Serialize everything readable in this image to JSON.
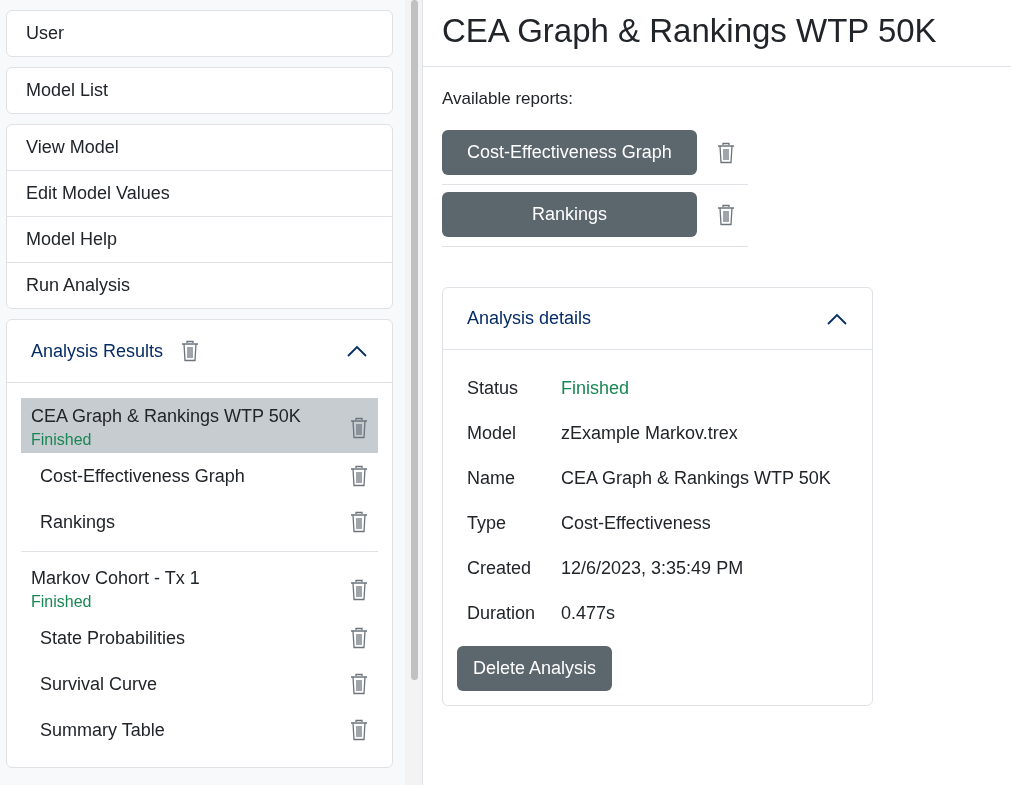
{
  "sidebar": {
    "top_items": [
      {
        "label": "User"
      },
      {
        "label": "Model List"
      }
    ],
    "model_items": [
      {
        "label": "View Model"
      },
      {
        "label": "Edit Model Values"
      },
      {
        "label": "Model Help"
      },
      {
        "label": "Run Analysis"
      }
    ],
    "analysis_results": {
      "title": "Analysis Results",
      "expanded": true,
      "results": [
        {
          "title": "CEA Graph & Rankings WTP 50K",
          "status": "Finished",
          "selected": true,
          "children": [
            {
              "label": "Cost-Effectiveness Graph"
            },
            {
              "label": "Rankings"
            }
          ]
        },
        {
          "title": "Markov Cohort - Tx 1",
          "status": "Finished",
          "selected": false,
          "children": [
            {
              "label": "State Probabilities"
            },
            {
              "label": "Survival Curve"
            },
            {
              "label": "Summary Table"
            }
          ]
        }
      ]
    }
  },
  "page_title": "CEA Graph & Rankings WTP 50K",
  "reports_label": "Available reports:",
  "reports": [
    {
      "label": "Cost-Effectiveness Graph"
    },
    {
      "label": "Rankings"
    }
  ],
  "details": {
    "title": "Analysis details",
    "expanded": true,
    "rows": [
      {
        "label": "Status",
        "value": "Finished",
        "kind": "status"
      },
      {
        "label": "Model",
        "value": "zExample Markov.trex",
        "kind": "text"
      },
      {
        "label": "Name",
        "value": "CEA Graph & Rankings WTP 50K",
        "kind": "text"
      },
      {
        "label": "Type",
        "value": "Cost-Effectiveness",
        "kind": "text"
      },
      {
        "label": "Created",
        "value": "12/6/2023, 3:35:49 PM",
        "kind": "text"
      },
      {
        "label": "Duration",
        "value": "0.477s",
        "kind": "text"
      }
    ],
    "delete_button": "Delete Analysis"
  }
}
